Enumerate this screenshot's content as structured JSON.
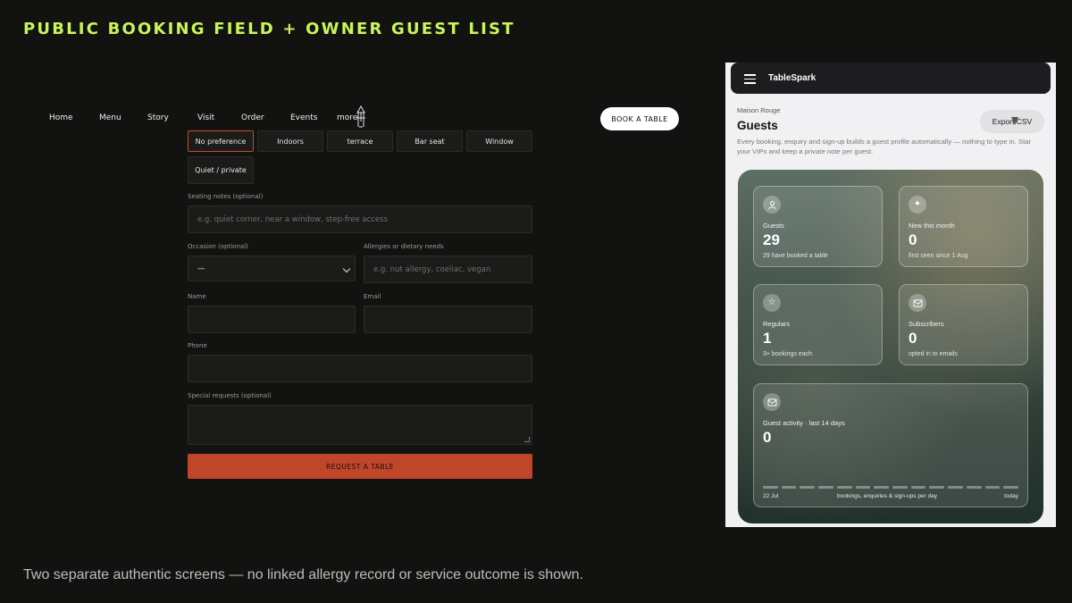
{
  "slide": {
    "title": "PUBLIC BOOKING FIELD + OWNER GUEST LIST",
    "caption": "Two separate authentic screens — no linked allergy record or service outcome is shown."
  },
  "site": {
    "nav": [
      "Home",
      "Menu",
      "Story",
      "Visit",
      "Order",
      "Events",
      "more"
    ],
    "book_button": "BOOK A TABLE"
  },
  "booking_form": {
    "seating_options": [
      {
        "label": "No preference",
        "selected": true
      },
      {
        "label": "Indoors",
        "selected": false
      },
      {
        "label": "terrace",
        "selected": false
      },
      {
        "label": "Bar seat",
        "selected": false
      },
      {
        "label": "Window",
        "selected": false
      },
      {
        "label": "Quiet / private",
        "selected": false
      }
    ],
    "seating_notes": {
      "label": "Seating notes (optional)",
      "placeholder": "e.g. quiet corner, near a window, step-free access"
    },
    "occasion": {
      "label": "Occasion (optional)",
      "value": "—"
    },
    "allergies": {
      "label": "Allergies or dietary needs",
      "placeholder": "e.g. nut allergy, coeliac, vegan"
    },
    "name": {
      "label": "Name",
      "value": ""
    },
    "email": {
      "label": "Email",
      "value": ""
    },
    "phone": {
      "label": "Phone",
      "value": ""
    },
    "special_requests": {
      "label": "Special requests (optional)",
      "value": ""
    },
    "submit": "REQUEST A TABLE",
    "accent": "#c0462a"
  },
  "owner_app": {
    "app_name": "TableSpark",
    "venue": "Maison Rouge",
    "page_title": "Guests",
    "export_button": "Export CSV",
    "description": "Every booking, enquiry and sign-up builds a guest profile automatically — nothing to type in. Star your VIPs and keep a private note per guest.",
    "stats": [
      {
        "icon": "users-icon",
        "label": "Guests",
        "value": "29",
        "sub": "29 have booked a table"
      },
      {
        "icon": "sparkle-icon",
        "label": "New this month",
        "value": "0",
        "sub": "first seen since 1 Aug"
      },
      {
        "icon": "star-icon",
        "label": "Regulars",
        "value": "1",
        "sub": "3+ bookings each"
      },
      {
        "icon": "mail-icon",
        "label": "Subscribers",
        "value": "0",
        "sub": "opted in to emails"
      }
    ],
    "activity": {
      "icon": "mail-icon",
      "label": "Guest activity · last 14 days",
      "value": "0",
      "start_label": "22 Jul",
      "middle_label": "bookings, enquiries & sign-ups per day",
      "end_label": "today",
      "daily_counts": [
        0,
        0,
        0,
        0,
        0,
        0,
        0,
        0,
        0,
        0,
        0,
        0,
        0,
        0
      ]
    }
  }
}
